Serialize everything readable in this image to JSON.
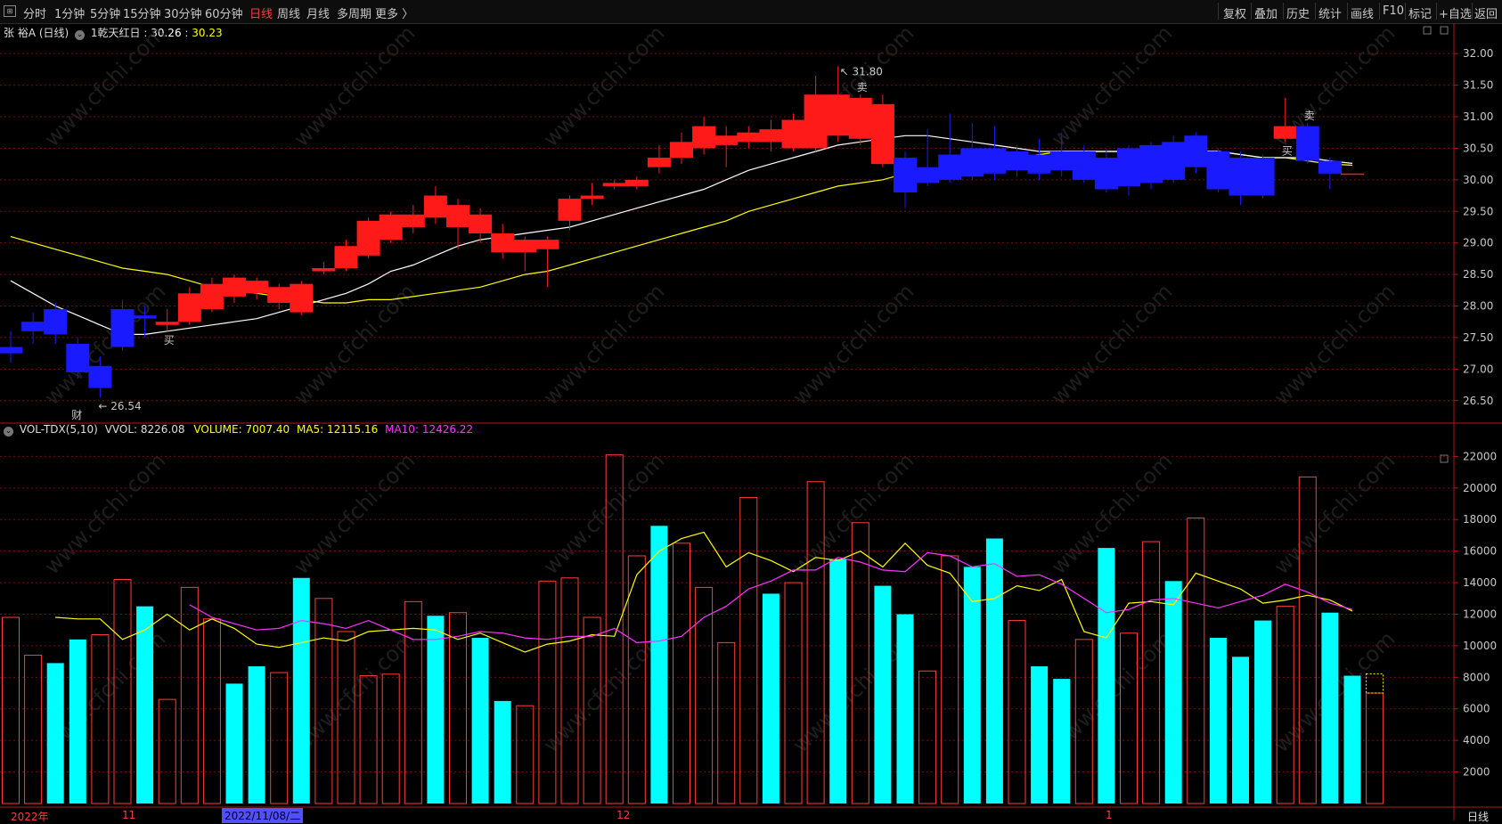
{
  "toolbar": {
    "periods": [
      "分时",
      "1分钟",
      "5分钟",
      "15分钟",
      "30分钟",
      "60分钟",
      "日线",
      "周线",
      "月线",
      "多周期",
      "更多 〉"
    ],
    "active_period": "日线",
    "right_items": [
      "复权",
      "叠加",
      "历史",
      "统计",
      "画线",
      "F10",
      "标记",
      "+自选",
      "返回"
    ]
  },
  "price_pane": {
    "stock_name": "张 裕A",
    "period_tag": "(日线)",
    "indicator_label": "1乾天红日 :",
    "indicator_val1": "30.26",
    "indicator_val1_color": "#ffffff",
    "indicator_val2": "30.23",
    "indicator_val2_color": "#ffff00",
    "high_label": "31.80",
    "low_label": "26.54",
    "buy_marker": "买",
    "sell_marker": "卖",
    "fin_marker": "财",
    "y_ticks": [
      "32.00",
      "31.50",
      "31.00",
      "30.50",
      "30.00",
      "29.50",
      "29.00",
      "28.50",
      "28.00",
      "27.50",
      "27.00",
      "26.50"
    ]
  },
  "volume_pane": {
    "name": "VOL-TDX(5,10)",
    "vvol_label": "VVOL:",
    "vvol_value": "8226.08",
    "volume_label": "VOLUME:",
    "volume_value": "7007.40",
    "ma5_label": "MA5:",
    "ma5_value": "12115.16",
    "ma10_label": "MA10:",
    "ma10_value": "12426.22",
    "colors": {
      "volume": "#ffff00",
      "ma5": "#ffff00",
      "ma10": "#ff33ff",
      "up": "#ff3c3c",
      "down": "#00ffff"
    },
    "y_ticks": [
      "22000",
      "20000",
      "18000",
      "16000",
      "14000",
      "12000",
      "10000",
      "8000",
      "6000",
      "4000",
      "2000"
    ]
  },
  "x_axis": {
    "labels": [
      "2022年",
      "11",
      "2022/11/08/二",
      "12",
      "1"
    ],
    "period_tag": "日线"
  },
  "watermark": "www.cfchi.com",
  "chart_data": {
    "type": "candlestick",
    "price_range": [
      26.2,
      32.2
    ],
    "volume_range": [
      0,
      22700
    ],
    "candles": [
      {
        "open": 27.35,
        "close": 27.25,
        "high": 27.6,
        "low": 27.1
      },
      {
        "open": 27.75,
        "close": 27.6,
        "high": 27.9,
        "low": 27.4
      },
      {
        "open": 27.95,
        "close": 27.55,
        "high": 28.05,
        "low": 27.4
      },
      {
        "open": 27.4,
        "close": 26.95,
        "high": 27.5,
        "low": 26.85
      },
      {
        "open": 27.05,
        "close": 26.7,
        "high": 27.2,
        "low": 26.55
      },
      {
        "open": 27.95,
        "close": 27.35,
        "high": 28.1,
        "low": 27.3
      },
      {
        "open": 27.85,
        "close": 27.8,
        "high": 28.0,
        "low": 27.5
      },
      {
        "open": 27.7,
        "close": 27.75,
        "high": 27.95,
        "low": 27.6
      },
      {
        "open": 27.75,
        "close": 28.2,
        "high": 28.3,
        "low": 27.7
      },
      {
        "open": 27.95,
        "close": 28.35,
        "high": 28.45,
        "low": 27.9
      },
      {
        "open": 28.15,
        "close": 28.45,
        "high": 28.5,
        "low": 28.05
      },
      {
        "open": 28.2,
        "close": 28.4,
        "high": 28.45,
        "low": 28.1
      },
      {
        "open": 28.05,
        "close": 28.3,
        "high": 28.35,
        "low": 27.95
      },
      {
        "open": 27.9,
        "close": 28.35,
        "high": 28.4,
        "low": 27.85
      },
      {
        "open": 28.55,
        "close": 28.6,
        "high": 28.7,
        "low": 28.5
      },
      {
        "open": 28.6,
        "close": 28.95,
        "high": 29.05,
        "low": 28.55
      },
      {
        "open": 28.8,
        "close": 29.35,
        "high": 29.4,
        "low": 28.75
      },
      {
        "open": 29.05,
        "close": 29.45,
        "high": 29.5,
        "low": 29.0
      },
      {
        "open": 29.25,
        "close": 29.45,
        "high": 29.6,
        "low": 29.15
      },
      {
        "open": 29.4,
        "close": 29.75,
        "high": 29.9,
        "low": 29.3
      },
      {
        "open": 29.25,
        "close": 29.6,
        "high": 29.7,
        "low": 28.9
      },
      {
        "open": 29.15,
        "close": 29.45,
        "high": 29.55,
        "low": 29.0
      },
      {
        "open": 28.85,
        "close": 29.15,
        "high": 29.3,
        "low": 28.75
      },
      {
        "open": 28.85,
        "close": 29.05,
        "high": 29.1,
        "low": 28.55
      },
      {
        "open": 28.9,
        "close": 29.05,
        "high": 29.1,
        "low": 28.3
      },
      {
        "open": 29.35,
        "close": 29.7,
        "high": 29.75,
        "low": 29.2
      },
      {
        "open": 29.7,
        "close": 29.75,
        "high": 29.95,
        "low": 29.6
      },
      {
        "open": 29.9,
        "close": 29.95,
        "high": 30.0,
        "low": 29.85
      },
      {
        "open": 29.9,
        "close": 30.0,
        "high": 30.05,
        "low": 29.85
      },
      {
        "open": 30.2,
        "close": 30.35,
        "high": 30.55,
        "low": 30.1
      },
      {
        "open": 30.35,
        "close": 30.6,
        "high": 30.75,
        "low": 30.25
      },
      {
        "open": 30.5,
        "close": 30.85,
        "high": 31.0,
        "low": 30.4
      },
      {
        "open": 30.55,
        "close": 30.7,
        "high": 30.85,
        "low": 30.2
      },
      {
        "open": 30.6,
        "close": 30.75,
        "high": 30.85,
        "low": 30.5
      },
      {
        "open": 30.6,
        "close": 30.8,
        "high": 30.95,
        "low": 30.45
      },
      {
        "open": 30.5,
        "close": 30.95,
        "high": 31.05,
        "low": 30.45
      },
      {
        "open": 30.5,
        "close": 31.35,
        "high": 31.65,
        "low": 30.45
      },
      {
        "open": 30.7,
        "close": 31.35,
        "high": 31.8,
        "low": 30.6
      },
      {
        "open": 30.65,
        "close": 31.3,
        "high": 31.35,
        "low": 30.55
      },
      {
        "open": 30.25,
        "close": 31.2,
        "high": 31.35,
        "low": 30.2
      },
      {
        "open": 30.35,
        "close": 29.8,
        "high": 30.45,
        "low": 29.55
      },
      {
        "open": 30.2,
        "close": 29.95,
        "high": 30.8,
        "low": 29.9
      },
      {
        "open": 30.4,
        "close": 30.0,
        "high": 31.05,
        "low": 29.95
      },
      {
        "open": 30.5,
        "close": 30.05,
        "high": 30.9,
        "low": 30.0
      },
      {
        "open": 30.5,
        "close": 30.1,
        "high": 30.85,
        "low": 30.0
      },
      {
        "open": 30.45,
        "close": 30.15,
        "high": 30.55,
        "low": 30.05
      },
      {
        "open": 30.4,
        "close": 30.1,
        "high": 30.65,
        "low": 30.0
      },
      {
        "open": 30.45,
        "close": 30.15,
        "high": 30.75,
        "low": 30.05
      },
      {
        "open": 30.45,
        "close": 30.0,
        "high": 30.55,
        "low": 29.95
      },
      {
        "open": 30.35,
        "close": 29.85,
        "high": 30.5,
        "low": 29.8
      },
      {
        "open": 30.5,
        "close": 29.9,
        "high": 30.55,
        "low": 29.75
      },
      {
        "open": 30.55,
        "close": 29.95,
        "high": 30.6,
        "low": 29.85
      },
      {
        "open": 30.6,
        "close": 30.0,
        "high": 30.7,
        "low": 29.95
      },
      {
        "open": 30.7,
        "close": 30.2,
        "high": 30.75,
        "low": 30.1
      },
      {
        "open": 30.45,
        "close": 29.85,
        "high": 30.5,
        "low": 29.8
      },
      {
        "open": 30.35,
        "close": 29.75,
        "high": 30.45,
        "low": 29.6
      },
      {
        "open": 30.35,
        "close": 29.75,
        "high": 30.4,
        "low": 29.7
      },
      {
        "open": 30.65,
        "close": 30.85,
        "high": 31.3,
        "low": 30.6
      },
      {
        "open": 30.85,
        "close": 30.3,
        "high": 30.9,
        "low": 30.25
      },
      {
        "open": 30.3,
        "close": 30.1,
        "high": 30.35,
        "low": 29.85
      },
      {
        "open": 30.1,
        "close": 30.1,
        "high": 30.1,
        "low": 30.1
      }
    ],
    "ma_white": [
      28.4,
      28.2,
      28.0,
      27.85,
      27.7,
      27.55,
      27.55,
      27.6,
      27.65,
      27.7,
      27.75,
      27.8,
      27.9,
      28.0,
      28.1,
      28.2,
      28.35,
      28.55,
      28.65,
      28.8,
      28.95,
      29.05,
      29.1,
      29.15,
      29.2,
      29.25,
      29.35,
      29.45,
      29.55,
      29.65,
      29.75,
      29.85,
      30.0,
      30.15,
      30.25,
      30.35,
      30.45,
      30.55,
      30.6,
      30.65,
      30.7,
      30.7,
      30.65,
      30.6,
      30.55,
      30.5,
      30.45,
      30.45,
      30.45,
      30.45,
      30.45,
      30.45,
      30.45,
      30.45,
      30.45,
      30.4,
      30.35,
      30.35,
      30.35,
      30.3,
      30.26
    ],
    "ma_yellow": [
      29.1,
      29.0,
      28.9,
      28.8,
      28.7,
      28.6,
      28.55,
      28.5,
      28.4,
      28.3,
      28.25,
      28.2,
      28.15,
      28.1,
      28.05,
      28.05,
      28.1,
      28.1,
      28.15,
      28.2,
      28.25,
      28.3,
      28.4,
      28.5,
      28.55,
      28.65,
      28.75,
      28.85,
      28.95,
      29.05,
      29.15,
      29.25,
      29.35,
      29.5,
      29.6,
      29.7,
      29.8,
      29.9,
      29.95,
      30.0,
      30.1,
      30.15,
      30.2,
      30.25,
      30.3,
      30.35,
      30.4,
      30.45,
      30.45,
      30.45,
      30.45,
      30.45,
      30.45,
      30.45,
      30.45,
      30.4,
      30.35,
      30.35,
      30.3,
      30.25,
      30.23
    ],
    "volumes": [
      11800,
      9400,
      8900,
      10400,
      10700,
      14200,
      12500,
      6600,
      13700,
      11700,
      7600,
      8700,
      8300,
      14300,
      13000,
      10900,
      8100,
      8200,
      12800,
      11900,
      12100,
      10500,
      6500,
      6200,
      14100,
      14300,
      11800,
      22100,
      15700,
      17600,
      16500,
      13700,
      10200,
      19400,
      13300,
      14000,
      20400,
      15500,
      17800,
      13800,
      12000,
      8400,
      15700,
      15000,
      16800,
      11600,
      8700,
      7900,
      10400,
      16200,
      10800,
      16600,
      14100,
      18100,
      10500,
      9300,
      11600,
      12500,
      20700,
      12100,
      8100,
      7000
    ],
    "vol_up": [
      true,
      true,
      false,
      false,
      true,
      true,
      false,
      true,
      true,
      true,
      false,
      false,
      true,
      false,
      true,
      true,
      true,
      true,
      true,
      false,
      true,
      false,
      false,
      true,
      true,
      true,
      true,
      true,
      true,
      false,
      true,
      true,
      true,
      true,
      false,
      true,
      true,
      false,
      true,
      false,
      false,
      true,
      true,
      false,
      false,
      true,
      false,
      false,
      true,
      false,
      true,
      true,
      false,
      true,
      false,
      false,
      false,
      true,
      true,
      false,
      false,
      true
    ],
    "vol_ma5": [
      11800,
      11700,
      11700,
      10400,
      11000,
      12000,
      11000,
      11700,
      11100,
      10100,
      9900,
      10200,
      10500,
      10300,
      10900,
      11000,
      11100,
      11000,
      10400,
      10800,
      10200,
      9600,
      10100,
      10300,
      10700,
      10600,
      14500,
      16000,
      16800,
      17200,
      15000,
      15900,
      15400,
      14700,
      15600,
      15400,
      16000,
      15000,
      16500,
      15100,
      14600,
      12800,
      13000,
      13800,
      13500,
      14200,
      10900,
      10500,
      12700,
      12800,
      12600,
      14600,
      14100,
      13600,
      12700,
      12900,
      13200,
      12900,
      12200
    ],
    "vol_ma10": [
      12600,
      11800,
      11400,
      11000,
      11100,
      11600,
      11400,
      11100,
      11600,
      11000,
      10400,
      10400,
      10600,
      10900,
      10800,
      10500,
      10400,
      10600,
      10600,
      11100,
      10200,
      10300,
      10600,
      11800,
      12500,
      13600,
      14100,
      14800,
      14800,
      15600,
      15300,
      14800,
      14700,
      15900,
      15700,
      15000,
      15200,
      14400,
      14500,
      13900,
      13000,
      12100,
      12300,
      12900,
      13000,
      12700,
      12400,
      12800,
      13200,
      13900,
      13400,
      12700,
      12300
    ],
    "buy_points": [
      7,
      57
    ],
    "sell_points": [
      38,
      58
    ]
  }
}
